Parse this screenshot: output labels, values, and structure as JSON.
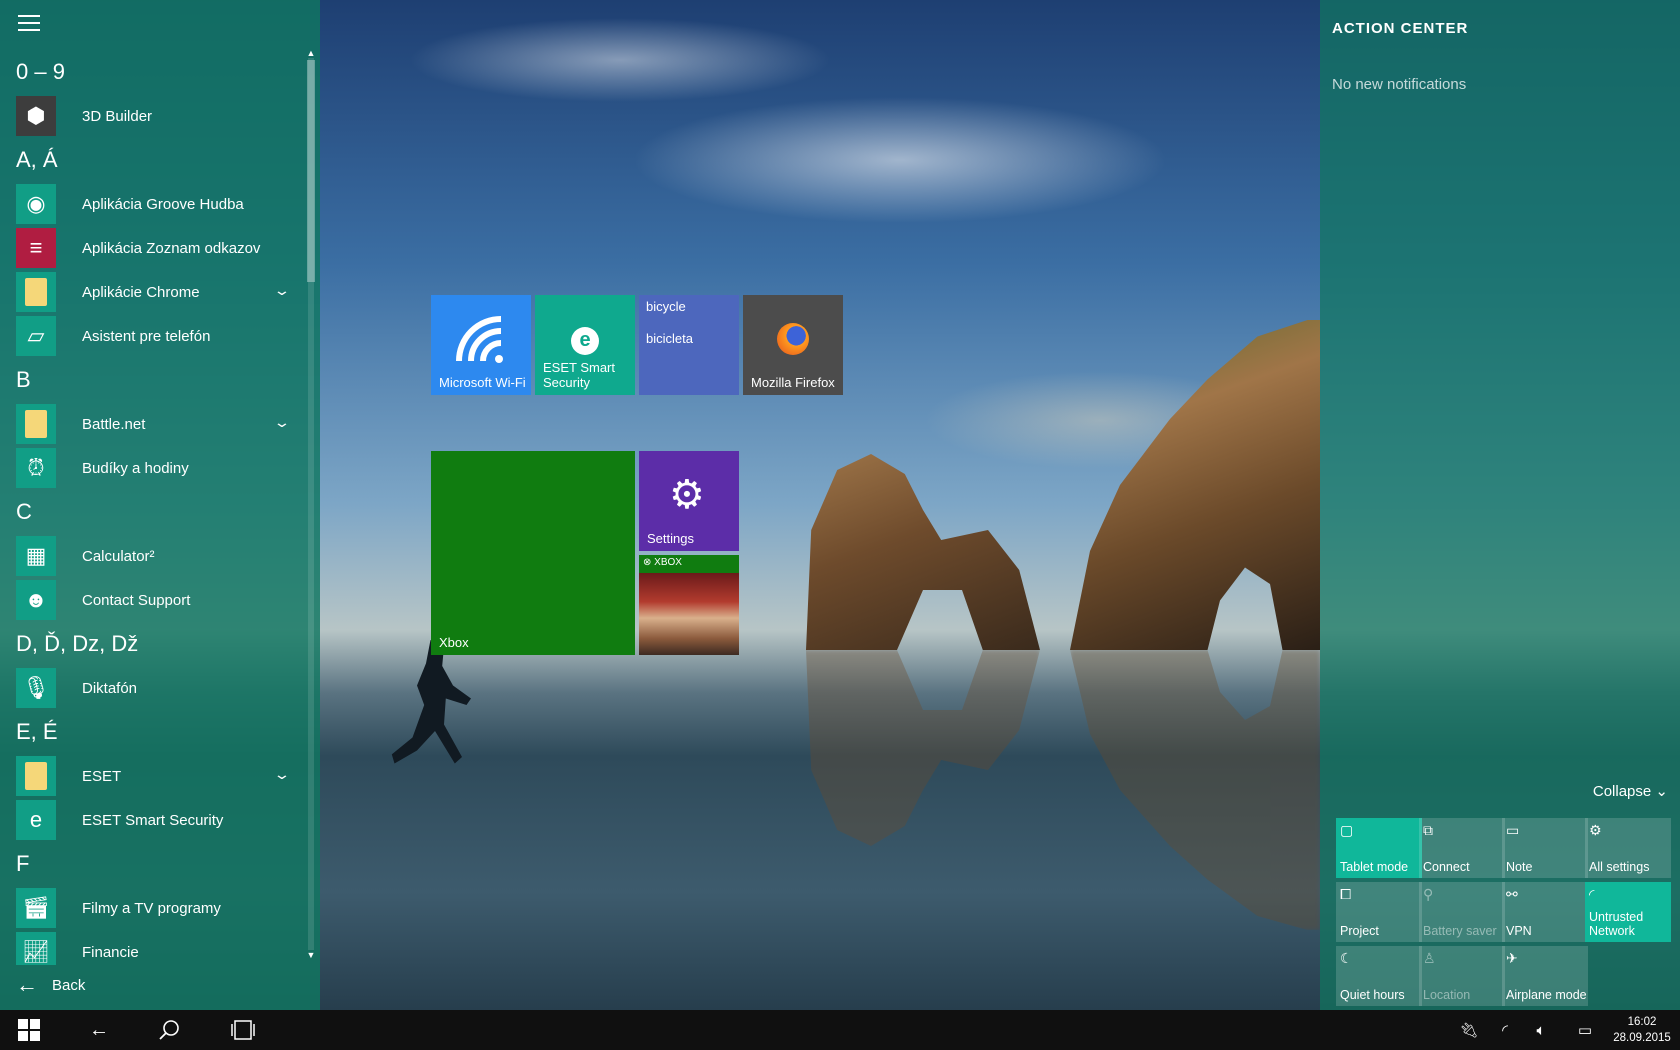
{
  "start_menu": {
    "back_label": "Back",
    "sections": [
      {
        "header": "0 – 9",
        "apps": [
          {
            "label": "3D Builder",
            "icon": "3d-builder-icon"
          }
        ]
      },
      {
        "header": "A, Á",
        "apps": [
          {
            "label": "Aplikácia Groove Hudba",
            "icon": "groove-music-icon"
          },
          {
            "label": "Aplikácia Zoznam odkazov",
            "icon": "reading-list-icon"
          },
          {
            "label": "Aplikácie Chrome",
            "icon": "folder-icon",
            "expandable": true
          },
          {
            "label": "Asistent pre telefón",
            "icon": "phone-companion-icon"
          }
        ]
      },
      {
        "header": "B",
        "apps": [
          {
            "label": "Battle.net",
            "icon": "folder-icon",
            "expandable": true
          },
          {
            "label": "Budíky a hodiny",
            "icon": "alarm-clock-icon"
          }
        ]
      },
      {
        "header": "C",
        "apps": [
          {
            "label": "Calculator²",
            "icon": "calculator-icon"
          },
          {
            "label": "Contact Support",
            "icon": "contact-support-icon"
          }
        ]
      },
      {
        "header": "D, Ď, Dz, Dž",
        "apps": [
          {
            "label": "Diktafón",
            "icon": "voice-recorder-icon"
          }
        ]
      },
      {
        "header": "E, É",
        "apps": [
          {
            "label": "ESET",
            "icon": "folder-icon",
            "expandable": true
          },
          {
            "label": "ESET Smart Security",
            "icon": "eset-icon"
          }
        ]
      },
      {
        "header": "F",
        "apps": [
          {
            "label": "Filmy a TV programy",
            "icon": "movies-tv-icon"
          },
          {
            "label": "Financie",
            "icon": "finance-icon"
          }
        ]
      }
    ]
  },
  "tiles": {
    "wifi": "Microsoft Wi-Fi",
    "eset_line1": "ESET Smart",
    "eset_line2": "Security",
    "bike_word1": "bicycle",
    "bike_word2": "bicicleta",
    "firefox": "Mozilla Firefox",
    "xbox": "Xbox",
    "settings": "Settings",
    "game_header": "XBOX"
  },
  "action_center": {
    "title": "ACTION CENTER",
    "empty": "No new notifications",
    "collapse": "Collapse",
    "quick_actions": [
      {
        "label": "Tablet mode",
        "icon": "tablet-mode-icon",
        "glyph": "▢",
        "state": "on"
      },
      {
        "label": "Connect",
        "icon": "connect-icon",
        "glyph": "⧉",
        "state": "off"
      },
      {
        "label": "Note",
        "icon": "note-icon",
        "glyph": "▭",
        "state": "off"
      },
      {
        "label": "All settings",
        "icon": "settings-icon",
        "glyph": "⚙",
        "state": "off"
      },
      {
        "label": "Project",
        "icon": "project-icon",
        "glyph": "⧠",
        "state": "off"
      },
      {
        "label": "Battery saver",
        "icon": "battery-saver-icon",
        "glyph": "⚲",
        "state": "dim"
      },
      {
        "label": "VPN",
        "icon": "vpn-icon",
        "glyph": "⚯",
        "state": "off"
      },
      {
        "label": "Untrusted Network",
        "icon": "network-icon",
        "glyph": "◜",
        "state": "on"
      },
      {
        "label": "Quiet hours",
        "icon": "moon-icon",
        "glyph": "☾",
        "state": "off"
      },
      {
        "label": "Location",
        "icon": "location-icon",
        "glyph": "♙",
        "state": "dim"
      },
      {
        "label": "Airplane mode",
        "icon": "airplane-icon",
        "glyph": "✈",
        "state": "off"
      }
    ]
  },
  "taskbar": {
    "time": "16:02",
    "date": "28.09.2015"
  }
}
